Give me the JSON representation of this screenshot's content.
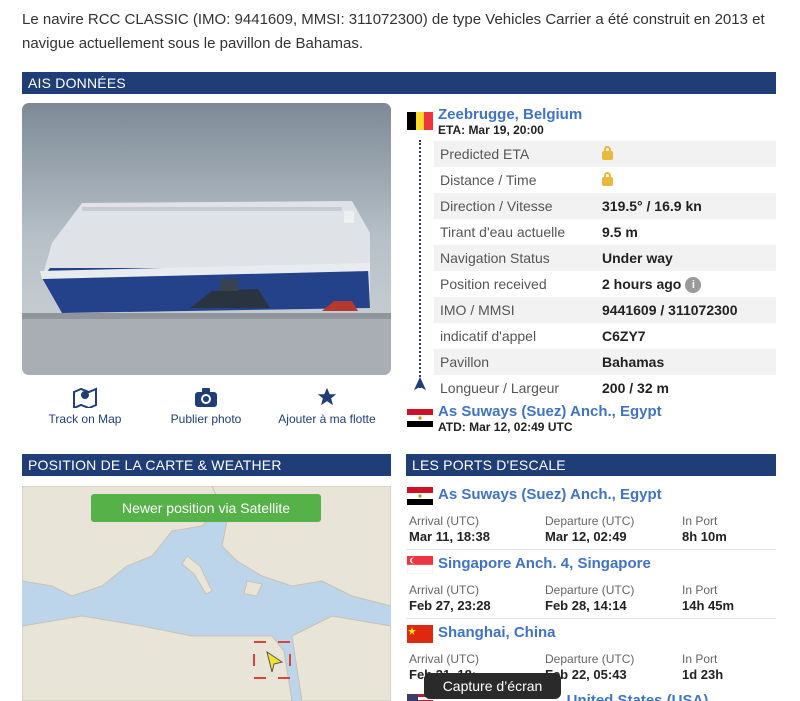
{
  "intro": "Le navire RCC CLASSIC (IMO: 9441609, MMSI: 311072300) de type Vehicles Carrier a été construit en 2013 et navigue actuellement sous le pavillon de Bahamas.",
  "sections": {
    "ais": "AIS DONNÉES",
    "map": "POSITION DE LA CARTE & WEATHER",
    "ports": "LES PORTS D'ESCALE"
  },
  "actions": {
    "track": "Track on Map",
    "photo": "Publier photo",
    "fleet": "Ajouter à ma flotte"
  },
  "destination": {
    "name": "Zeebrugge, Belgium",
    "eta": "ETA: Mar 19, 20:00"
  },
  "departure": {
    "name": "As Suways (Suez) Anch., Egypt",
    "atd": "ATD: Mar 12, 02:49 UTC"
  },
  "details": [
    {
      "label": "Predicted ETA",
      "value": ""
    },
    {
      "label": "Distance / Time",
      "value": ""
    },
    {
      "label": "Direction / Vitesse",
      "value": "319.5° / 16.9 kn"
    },
    {
      "label": "Tirant d'eau actuelle",
      "value": "9.5 m"
    },
    {
      "label": "Navigation Status",
      "value": "Under way"
    },
    {
      "label": "Position received",
      "value": "2 hours ago"
    },
    {
      "label": "IMO / MMSI",
      "value": "9441609 / 311072300"
    },
    {
      "label": "indicatif d'appel",
      "value": "C6ZY7"
    },
    {
      "label": "Pavillon",
      "value": "Bahamas"
    },
    {
      "label": "Longueur / Largeur",
      "value": "200 / 32 m"
    }
  ],
  "info_glyph": "i",
  "map": {
    "satellite_button": "Newer position via Satellite"
  },
  "column_labels": {
    "arrival": "Arrival (UTC)",
    "departure": "Departure (UTC)",
    "in_port": "In Port"
  },
  "ports_of_call": [
    {
      "name": "As Suways (Suez) Anch., Egypt",
      "arrival": "Mar 11, 18:38",
      "departure": "Mar 12, 02:49",
      "in_port": "8h 10m"
    },
    {
      "name": "Singapore Anch. 4, Singapore",
      "arrival": "Feb 27, 23:28",
      "departure": "Feb 28, 14:14",
      "in_port": "14h 45m"
    },
    {
      "name": "Shanghai, China",
      "arrival": "Feb 21, 18:..",
      "departure": "Feb 22, 05:43",
      "in_port": "1d 23h"
    },
    {
      "name": "... United States (USA)"
    }
  ],
  "tooltip": "Capture d’écran",
  "colors": {
    "section_bar": "#1f3e78",
    "link": "#3f74c4",
    "satellite_button": "#56b148",
    "lock": "#e8b93a"
  }
}
